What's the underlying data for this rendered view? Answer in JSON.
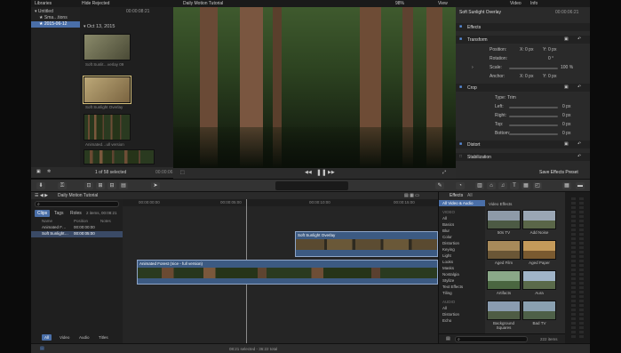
{
  "browser": {
    "title_libraries": "Libraries",
    "title_filter": "Hide Rejected",
    "timecode_top": "00:00:08:21",
    "library_name": "Untitled",
    "event_name": "Sma…tions",
    "date_event": "2015-06-12",
    "date_group": "Oct 13, 2015",
    "clips": [
      {
        "label": "Soft Sunlit…verlay 09"
      },
      {
        "label": "Soft Sunlight Overlay"
      },
      {
        "label": "Animated…ull version"
      }
    ],
    "selection_status": "1 of 58 selected",
    "selection_time": "00:00:06:00"
  },
  "viewer": {
    "title": "Daily Motion Tutorial",
    "zoom": "98%",
    "view_label": "View"
  },
  "inspector": {
    "tab_video": "Video",
    "tab_info": "Info",
    "clip_name": "Soft Sunlight Overlay",
    "clip_time": "00:00:06:21",
    "sections": {
      "effects": "Effects",
      "transform": "Transform",
      "crop": "Crop",
      "distort": "Distort",
      "stabilization": "Stabilization"
    },
    "transform_rows": [
      {
        "label": "Position:",
        "x_label": "X:",
        "x": "0 px",
        "y_label": "Y:",
        "y": "0 px"
      },
      {
        "label": "Rotation:",
        "value": "0 °"
      },
      {
        "label": "Scale:",
        "value": "100 %"
      },
      {
        "label": "Anchor:",
        "x_label": "X:",
        "x": "0 px",
        "y_label": "Y:",
        "y": "0 px"
      }
    ],
    "crop_type_label": "Type:",
    "crop_type": "Trim",
    "crop_rows": [
      {
        "label": "Left:",
        "value": "0 px"
      },
      {
        "label": "Right:",
        "value": "0 px"
      },
      {
        "label": "Top:",
        "value": "0 px"
      },
      {
        "label": "Bottom:",
        "value": "0 px"
      }
    ],
    "save_preset": "Save Effects Preset"
  },
  "timeline": {
    "project_title": "Daily Motion Tutorial",
    "tabs": [
      "Clips",
      "Tags",
      "Roles"
    ],
    "index_count": "2 items, 00:08:21",
    "col_name": "Name",
    "col_position": "Position",
    "col_notes": "Notes",
    "index_rows": [
      {
        "name": "Animated F…",
        "position": "00:00:00:00"
      },
      {
        "name": "Soft Sunlight…",
        "position": "00:00:05:00"
      }
    ],
    "bottom_tabs": [
      "All",
      "Video",
      "Audio",
      "Titles"
    ],
    "ruler": [
      "00:00:00:00",
      "00:00:05:00",
      "00:00:10:00",
      "00:00:15:00"
    ],
    "clip_overlay": "Soft Sunlight Overlay",
    "clip_main": "Animated Forest (nice - full version)",
    "status": "08:21 selected - 36:22 total"
  },
  "effects": {
    "title": "Effects",
    "all_label": "All",
    "top_item": "All Video & Audio",
    "header": "Video Effects",
    "categories_video_header": "VIDEO",
    "categories": [
      "All",
      "Basics",
      "Blur",
      "Color",
      "Distortion",
      "Keying",
      "Light",
      "Looks",
      "Masks",
      "Nostalgia",
      "Stylize",
      "Text Effects",
      "Tiling"
    ],
    "categories_audio_header": "AUDIO",
    "audio_categories": [
      "All",
      "Distortion",
      "Echo"
    ],
    "items": [
      {
        "label": "50s TV",
        "color": "#7d8a98"
      },
      {
        "label": "Add Noise",
        "color": "#6f7a86"
      },
      {
        "label": "Aged Film",
        "color": "#8a7250"
      },
      {
        "label": "Aged Paper",
        "color": "#9a7a4a"
      },
      {
        "label": "Artifacts",
        "color": "#6e8a6a"
      },
      {
        "label": "Aura",
        "color": "#7a8fa6"
      },
      {
        "label": "Background Squares",
        "color": "#6a7c8e"
      },
      {
        "label": "Bad TV",
        "color": "#6a8090"
      }
    ],
    "count": "222 items"
  }
}
